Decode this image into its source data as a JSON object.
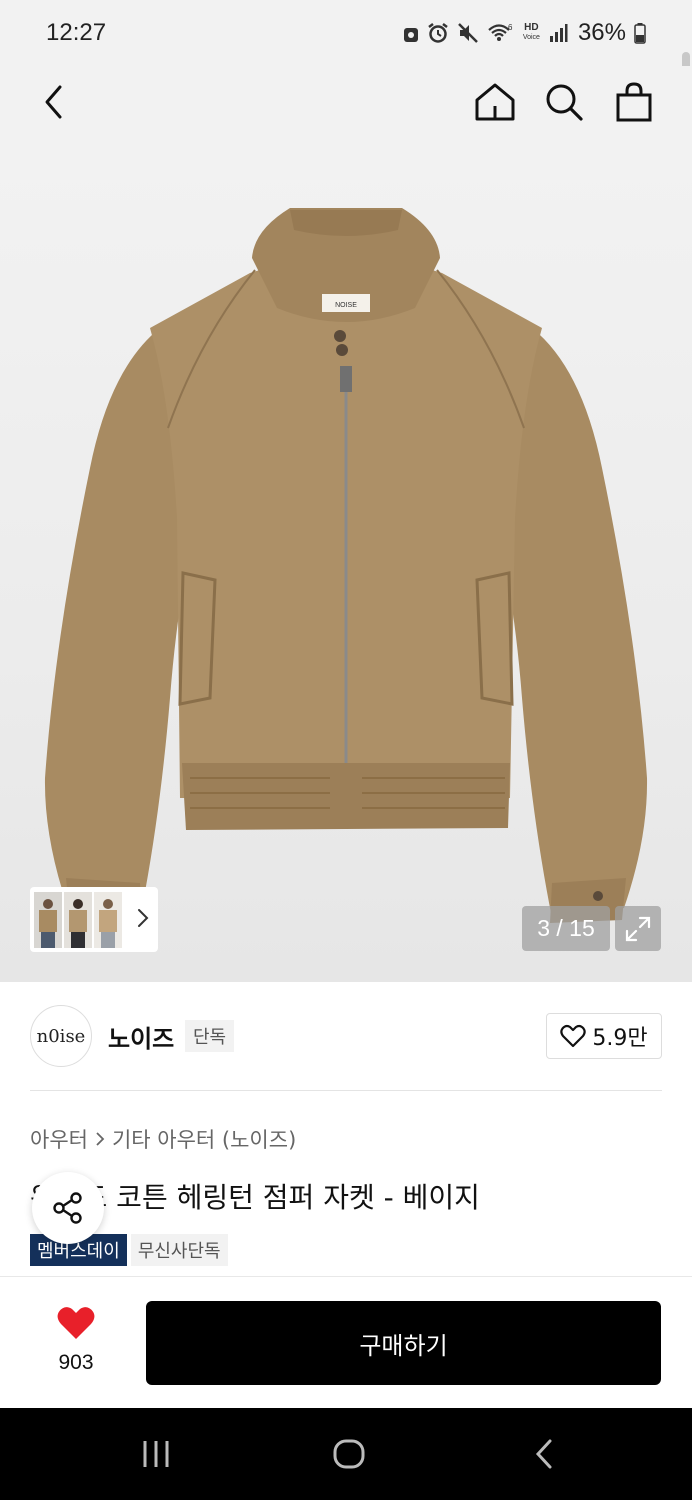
{
  "status_bar": {
    "time": "12:27",
    "network_label": "HD",
    "network_sub": "Voice",
    "battery": "36%"
  },
  "header": {
    "icons": [
      "back-icon",
      "home-icon",
      "search-icon",
      "shopping-bag-icon"
    ]
  },
  "gallery": {
    "counter": "3 / 15",
    "brand_label_on_jacket": "NOISE"
  },
  "brand": {
    "logo_text": "n0ise",
    "name": "노이즈",
    "tag": "단독",
    "likes": "5.9만"
  },
  "product": {
    "breadcrumb": [
      "아우터",
      "기타 아우터 (노이즈)"
    ],
    "title": "워시드 코튼 헤링턴 점퍼 자켓 - 베이지",
    "badges": [
      "멤버스데이",
      "무신사단독"
    ]
  },
  "bottom_bar": {
    "wish_count": "903",
    "buy_label": "구매하기"
  },
  "colors": {
    "jacket": "#a88b62",
    "buy_button": "#000000",
    "heart": "#e8202a",
    "member_badge": "#14305a"
  }
}
